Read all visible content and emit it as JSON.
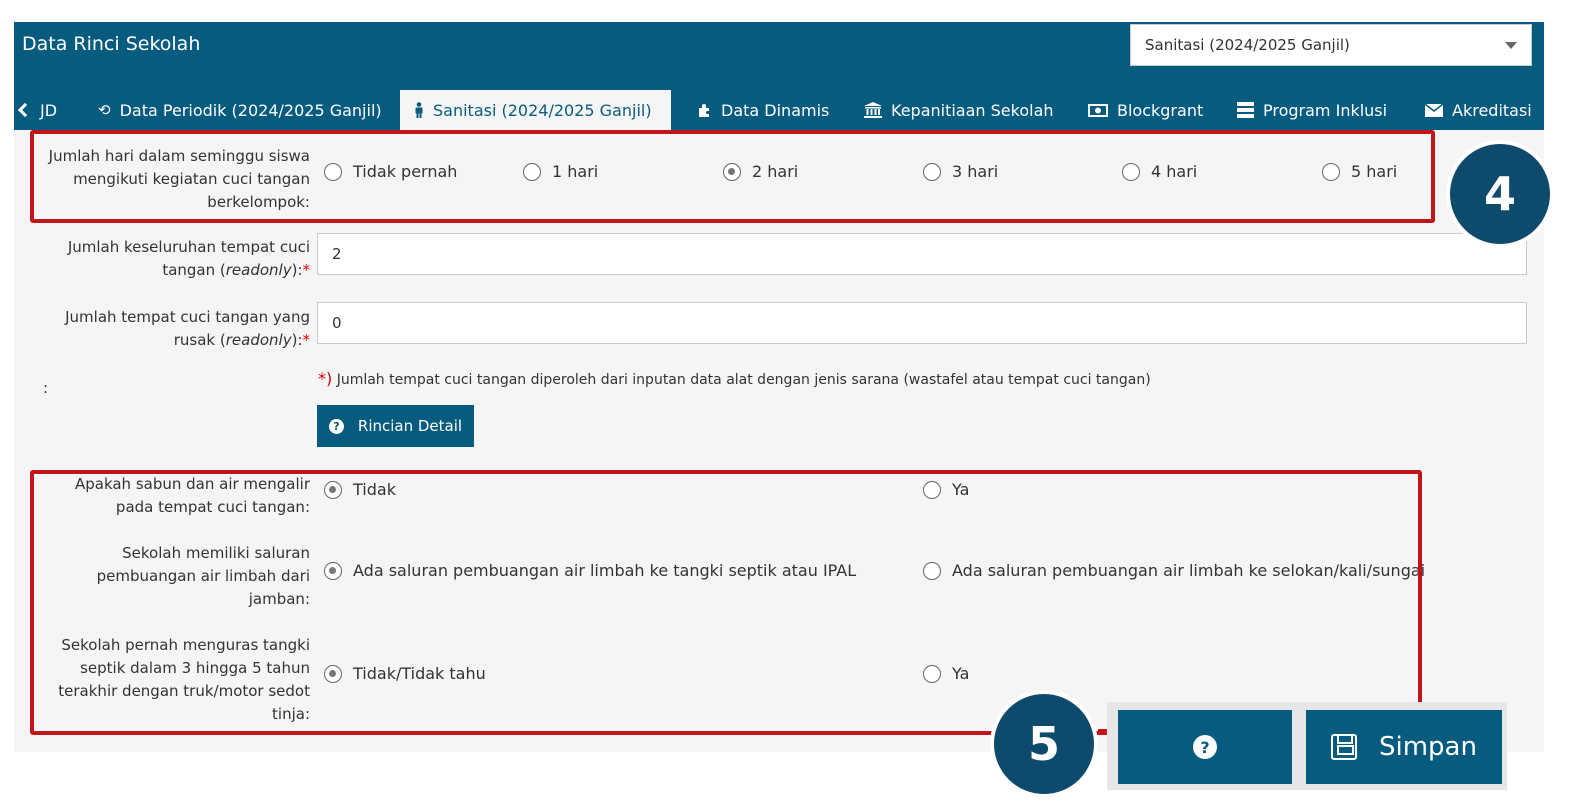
{
  "header": {
    "title": "Data Rinci Sekolah",
    "period_select": "Sanitasi (2024/2025 Ganjil)"
  },
  "tabs": [
    {
      "label": "JD",
      "icon": "chevron-left-icon"
    },
    {
      "label": "Data Periodik (2024/2025 Ganjil)",
      "icon": "history-icon"
    },
    {
      "label": "Sanitasi (2024/2025 Ganjil)",
      "icon": "person-icon",
      "active": true
    },
    {
      "label": "Data Dinamis",
      "icon": "puzzle-icon"
    },
    {
      "label": "Kepanitiaan Sekolah",
      "icon": "institution-icon"
    },
    {
      "label": "Blockgrant",
      "icon": "money-icon"
    },
    {
      "label": "Program Inklusi",
      "icon": "server-icon"
    },
    {
      "label": "Akreditasi",
      "icon": "envelope-icon"
    }
  ],
  "form": {
    "cuci_tangan_kelompok": {
      "label_lines": [
        "Jumlah hari dalam seminggu siswa",
        "mengikuti kegiatan cuci tangan",
        "berkelompok:"
      ],
      "options": [
        "Tidak pernah",
        "1 hari",
        "2 hari",
        "3 hari",
        "4 hari",
        "5 hari"
      ],
      "selected": "2 hari"
    },
    "total_tempat_cuci": {
      "label_line1": "Jumlah keseluruhan tempat cuci",
      "label_prefix": "tangan (",
      "label_italic": "readonly",
      "label_suffix": "):",
      "required_mark": "*",
      "value": "2"
    },
    "tempat_cuci_rusak": {
      "label_line1": "Jumlah tempat cuci tangan yang",
      "label_prefix": "rusak (",
      "label_italic": "readonly",
      "label_suffix": "):",
      "required_mark": "*",
      "value": "0"
    },
    "colon": ":",
    "note_mark": "*)",
    "note": "Jumlah tempat cuci tangan diperoleh dari inputan data alat dengan jenis sarana (wastafel atau tempat cuci tangan)",
    "detail_button": "Rincian Detail",
    "sabun_air": {
      "label_lines": [
        "Apakah sabun dan air mengalir",
        "pada tempat cuci tangan:"
      ],
      "options": [
        "Tidak",
        "Ya"
      ],
      "selected": "Tidak"
    },
    "saluran_limbah": {
      "label_lines": [
        "Sekolah memiliki saluran",
        "pembuangan air limbah dari",
        "jamban:"
      ],
      "options": [
        "Ada saluran pembuangan air limbah ke tangki septik atau IPAL",
        "Ada saluran pembuangan air limbah ke selokan/kali/sungai"
      ],
      "selected": "Ada saluran pembuangan air limbah ke tangki septik atau IPAL"
    },
    "kuras_septik": {
      "label_lines": [
        "Sekolah pernah menguras tangki",
        "septik dalam 3 hingga 5 tahun",
        "terakhir dengan truk/motor sedot",
        "tinja:"
      ],
      "options": [
        "Tidak/Tidak tahu",
        "Ya"
      ],
      "selected": "Tidak/Tidak tahu"
    }
  },
  "annotations": {
    "badge_4": "4",
    "badge_5": "5",
    "highlight_color": "#c4141b",
    "badge_color": "#0e4a6c"
  },
  "actions": {
    "help_icon": "question-circle-icon",
    "save_label": "Simpan",
    "save_icon": "floppy-disk-icon"
  }
}
